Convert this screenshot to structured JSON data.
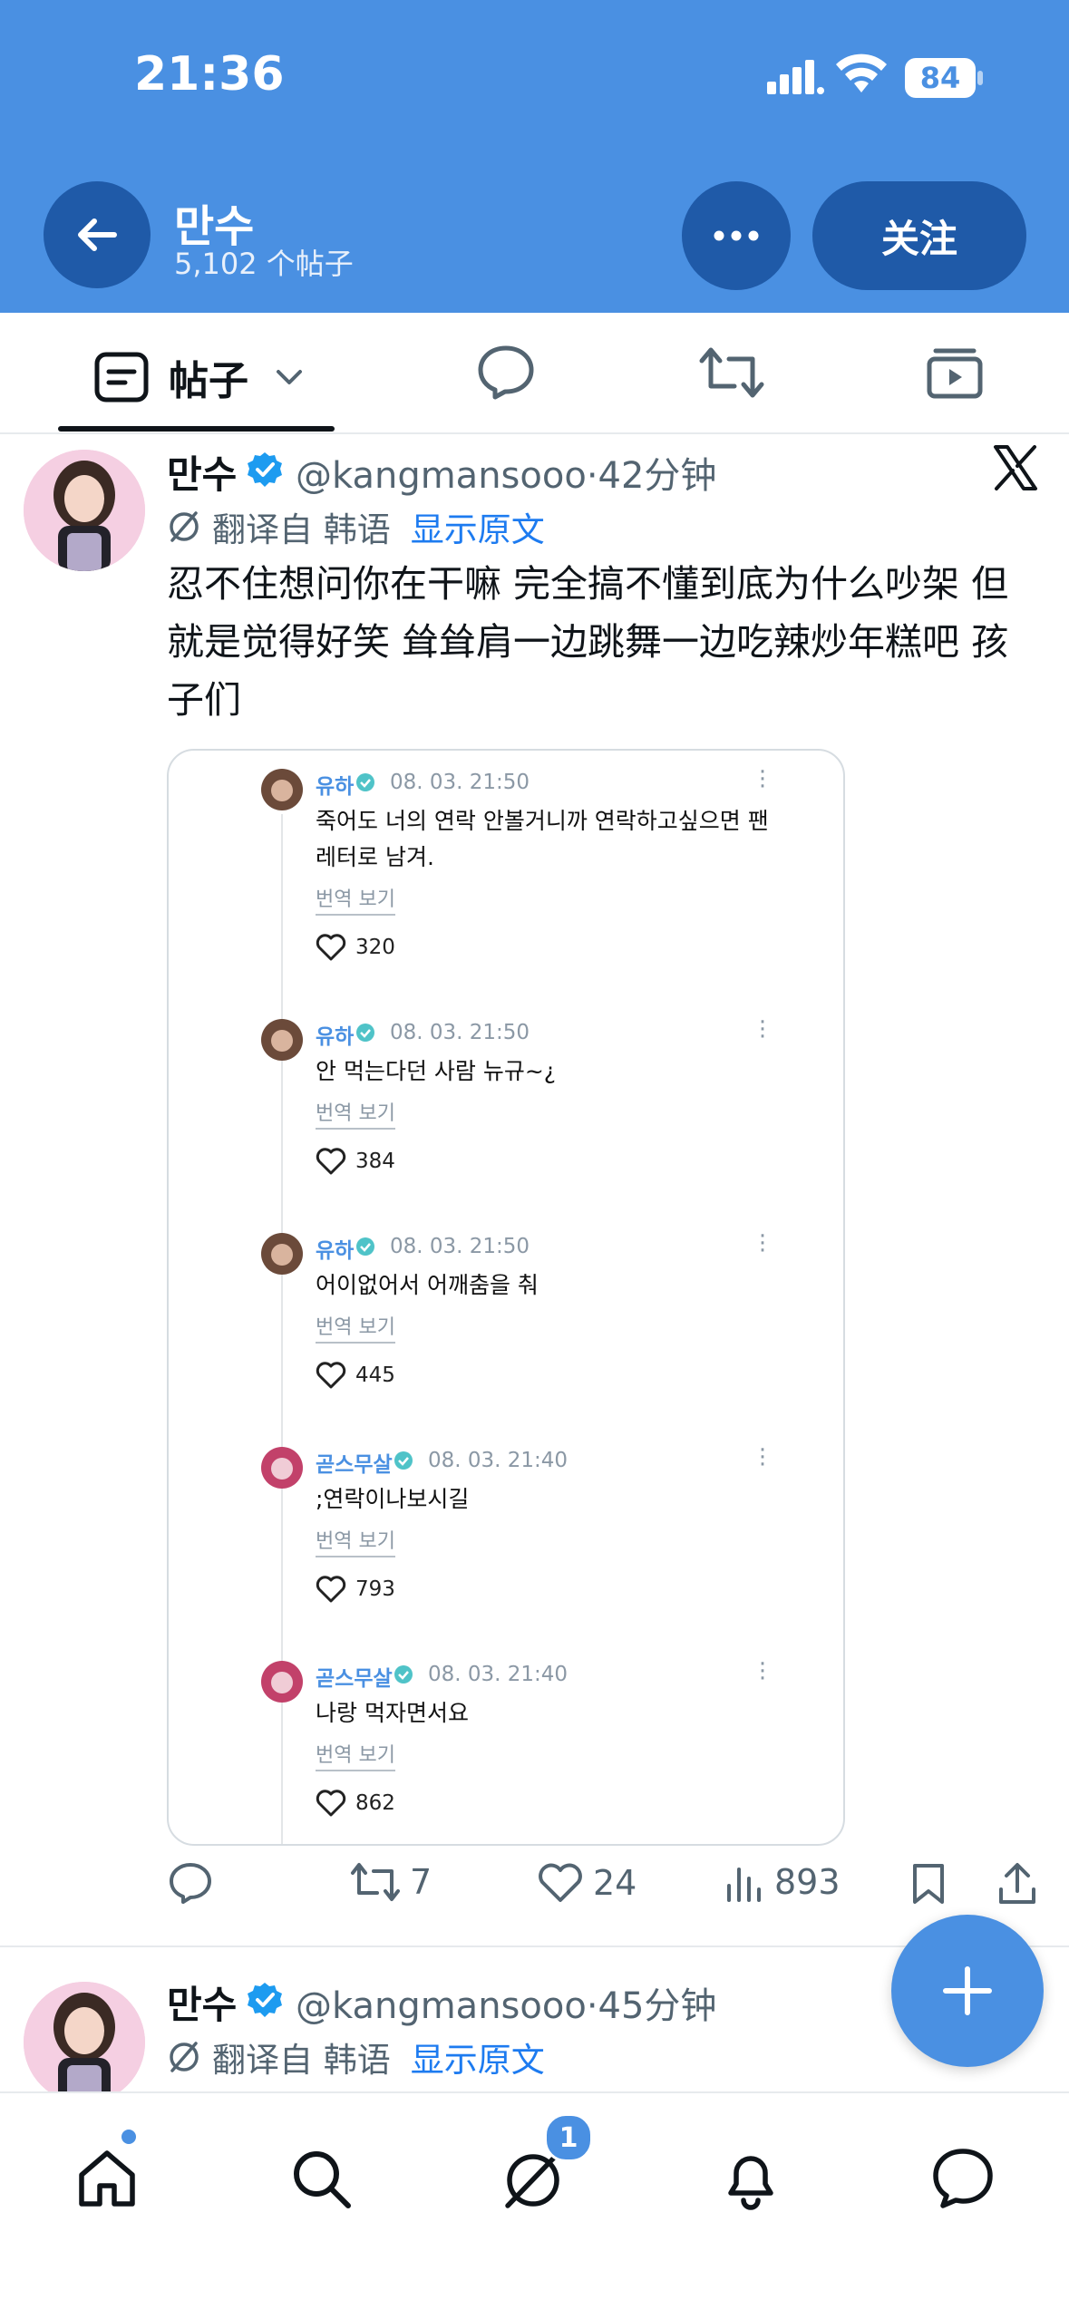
{
  "status_bar": {
    "time": "21:36",
    "battery": "84"
  },
  "header": {
    "name": "만수",
    "post_count": "5,102 个帖子",
    "follow_label": "关注"
  },
  "tabs": {
    "posts_label": "帖子"
  },
  "post1": {
    "name": "만수",
    "handle": "@kangmansooo",
    "time": "·42分钟",
    "translated_label": "翻译自 韩语",
    "show_original": "显示原文",
    "body": "忍不住想问你在干嘛 完全搞不懂到底为什么吵架 但就是觉得好笑 耸耸肩一边跳舞一边吃辣炒年糕吧 孩子们",
    "comments": [
      {
        "user": "유하",
        "date": "08. 03. 21:50",
        "text": "죽어도 너의 연락 안볼거니까 연락하고싶으면 팬레터로 남겨.",
        "translate": "번역 보기",
        "likes": "320"
      },
      {
        "user": "유하",
        "date": "08. 03. 21:50",
        "text": "안 먹는다던 사람 뉴규~¿",
        "translate": "번역 보기",
        "likes": "384"
      },
      {
        "user": "유하",
        "date": "08. 03. 21:50",
        "text": "어이없어서 어깨춤을 춰",
        "translate": "번역 보기",
        "likes": "445"
      },
      {
        "user": "곧스무살",
        "date": "08. 03. 21:40",
        "text": ";연락이나보시길",
        "translate": "번역 보기",
        "likes": "793"
      },
      {
        "user": "곧스무살",
        "date": "08. 03. 21:40",
        "text": "나랑 먹자면서요",
        "translate": "번역 보기",
        "likes": "862"
      }
    ],
    "actions": {
      "reposts": "7",
      "likes": "24",
      "views": "893"
    }
  },
  "post2": {
    "name": "만수",
    "handle": "@kangmansooo",
    "time": "·45分钟",
    "translated_label": "翻译自 韩语",
    "show_original": "显示原文"
  },
  "nav": {
    "messages_badge": "1"
  },
  "colors": {
    "header_bg": "#4a90e2",
    "accent": "#1d7bf0",
    "verified": "#1d9bf0"
  }
}
